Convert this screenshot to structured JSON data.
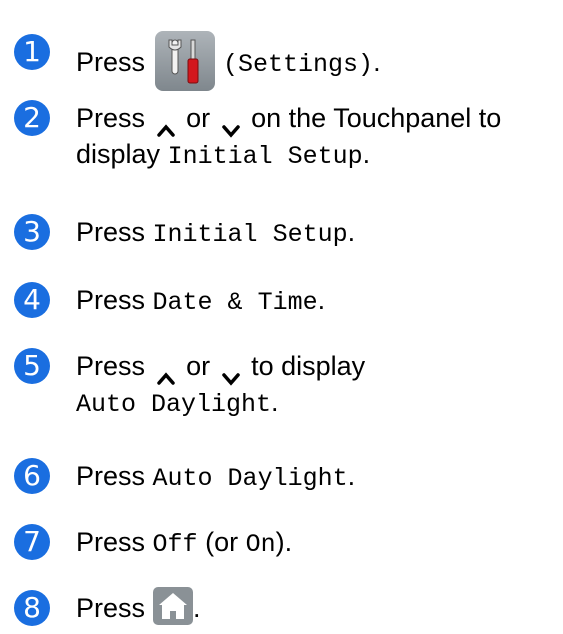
{
  "colors": {
    "badge": "#1a6ee0"
  },
  "steps": [
    {
      "num": "1",
      "press": "Press",
      "settings_label": "(Settings)",
      "end": "."
    },
    {
      "num": "2",
      "line1": "Press",
      "or": "or",
      "line1_end": "on the Touchpanel to",
      "line2_prefix": "display",
      "target": "Initial Setup",
      "end": "."
    },
    {
      "num": "3",
      "press": "Press",
      "target": "Initial Setup",
      "end": "."
    },
    {
      "num": "4",
      "press": "Press",
      "target": "Date & Time",
      "end": "."
    },
    {
      "num": "5",
      "line1": "Press",
      "or": "or",
      "line1_end": "to display",
      "target": "Auto Daylight",
      "end": "."
    },
    {
      "num": "6",
      "press": "Press",
      "target": "Auto Daylight",
      "end": "."
    },
    {
      "num": "7",
      "press": "Press",
      "target": "Off",
      "paren_open": "(or",
      "target2": "On",
      "paren_close": ")."
    },
    {
      "num": "8",
      "press": "Press",
      "end": "."
    }
  ],
  "icons": {
    "settings": "settings-icon",
    "up": "chevron-up-icon",
    "down": "chevron-down-icon",
    "home": "home-icon"
  }
}
